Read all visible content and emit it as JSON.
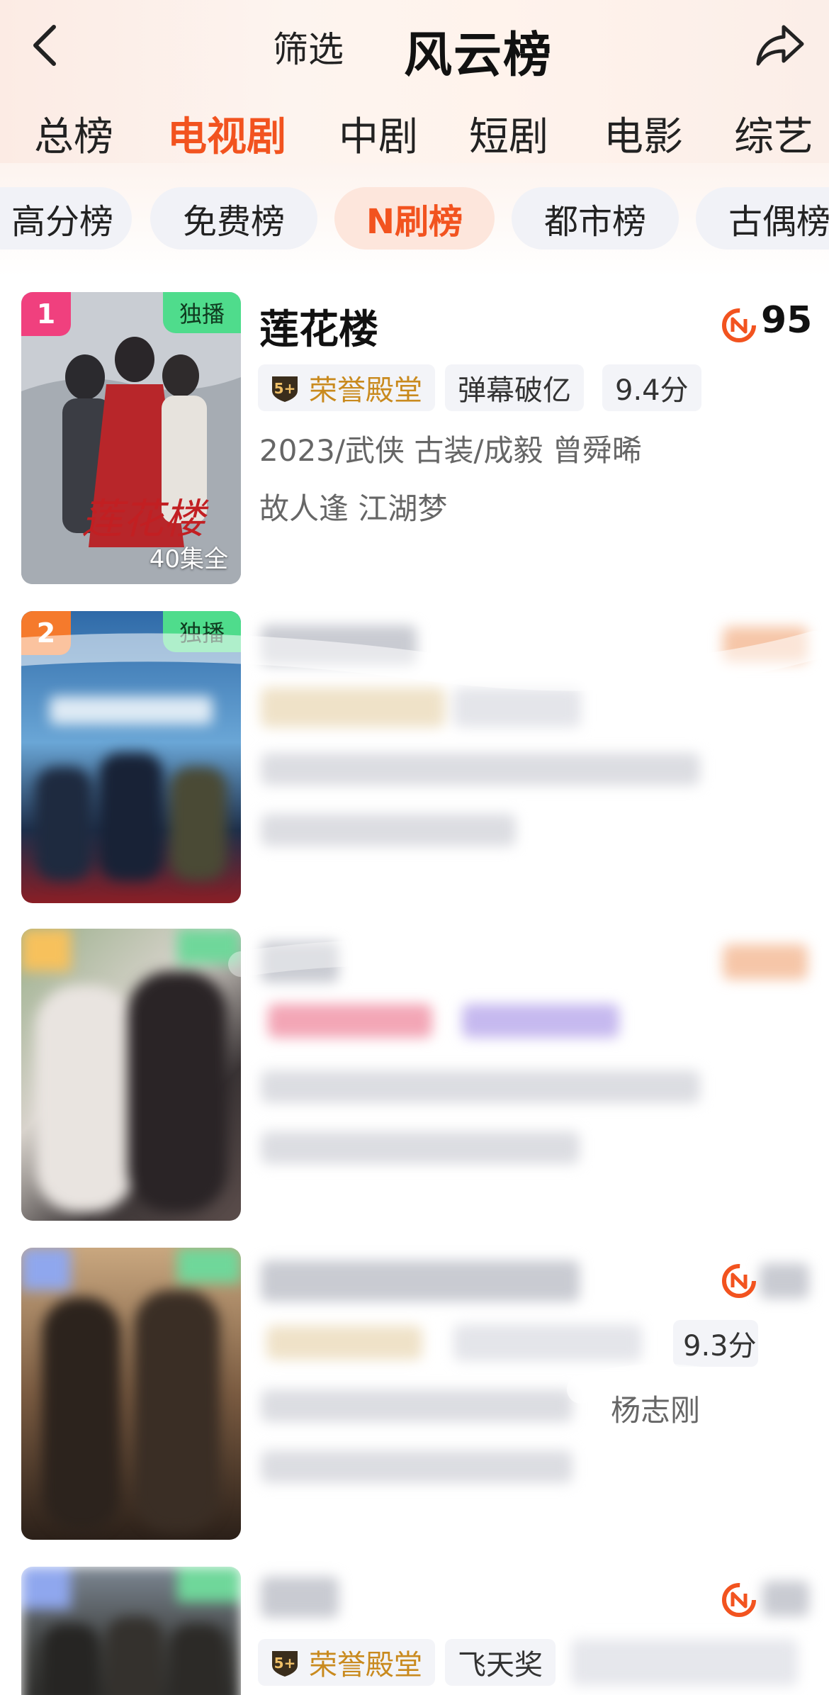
{
  "header": {
    "back_icon": "chevron-left-icon",
    "filter_label": "筛选",
    "title": "风云榜",
    "share_icon": "share-icon"
  },
  "category_tabs": [
    {
      "label": "总榜",
      "active": false
    },
    {
      "label": "电视剧",
      "active": true
    },
    {
      "label": "中剧",
      "active": false
    },
    {
      "label": "短剧",
      "active": false
    },
    {
      "label": "电影",
      "active": false
    },
    {
      "label": "综艺",
      "active": false
    }
  ],
  "sub_chips": [
    {
      "label": "高分榜",
      "active": false
    },
    {
      "label": "免费榜",
      "active": false
    },
    {
      "label": "N刷榜",
      "active": true
    },
    {
      "label": "都市榜",
      "active": false
    },
    {
      "label": "古偶榜",
      "active": false
    }
  ],
  "colors": {
    "accent": "#f2531f",
    "honor_gold": "#c98a1e",
    "exclusive_green": "#4fdc8c",
    "rank1": "#f0407e",
    "rank2": "#f57a2c"
  },
  "list": [
    {
      "rank": "1",
      "exclusive": "独播",
      "episodes": "40集全",
      "title": "莲花楼",
      "score": "95",
      "tags": [
        "荣誉殿堂",
        "弹幕破亿",
        "9.4分"
      ],
      "meta": "2023/武侠 古装/成毅 曾舜晞",
      "desc": "故人逢 江湖梦"
    },
    {
      "rank": "2",
      "exclusive": "独播",
      "title": "",
      "score": ""
    },
    {
      "rank": "",
      "title": "",
      "score": ""
    },
    {
      "rank": "",
      "title": "",
      "score": "",
      "tags": [
        "9.3分"
      ],
      "meta_fragment": "杨志刚"
    },
    {
      "rank": "",
      "title": "",
      "score": "",
      "tags": [
        "荣誉殿堂",
        "飞天奖"
      ]
    }
  ]
}
